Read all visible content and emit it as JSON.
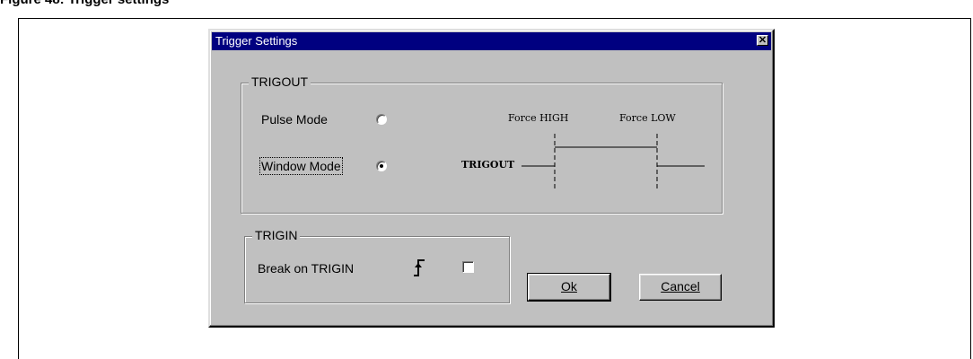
{
  "figure": {
    "caption": "Figure 48: Trigger settings"
  },
  "dialog": {
    "title": "Trigger Settings",
    "close_glyph": "✕",
    "trigout": {
      "group_label": "TRIGOUT",
      "pulse_mode_label": "Pulse Mode",
      "pulse_mode_selected": false,
      "window_mode_label": "Window Mode",
      "window_mode_selected": true,
      "diagram": {
        "force_high_label": "Force HIGH",
        "force_low_label": "Force LOW",
        "signal_label": "TRIGOUT"
      }
    },
    "trigin": {
      "group_label": "TRIGIN",
      "break_label": "Break on TRIGIN",
      "edge_icon": "rising-edge-icon",
      "break_checked": false
    },
    "buttons": {
      "ok_label": "Ok",
      "cancel_label": "Cancel"
    }
  }
}
